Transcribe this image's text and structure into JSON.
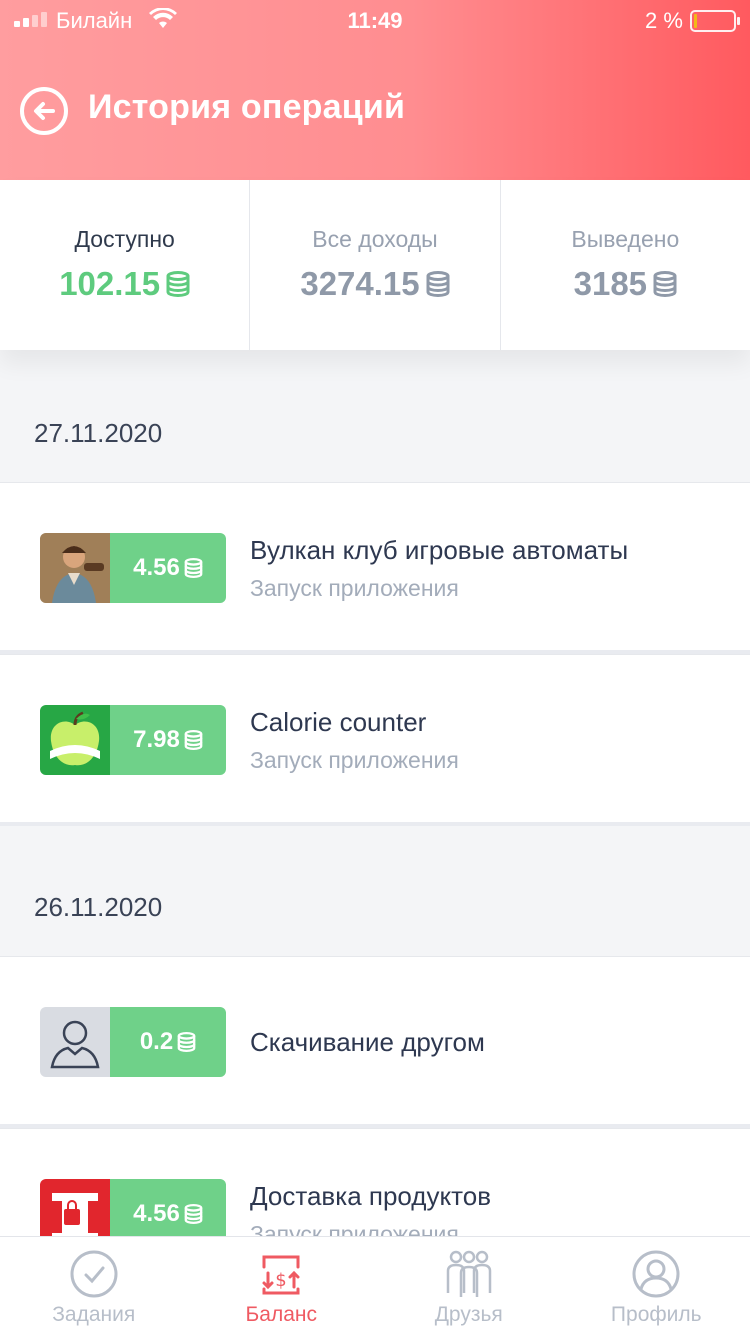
{
  "status_bar": {
    "carrier": "Билайн",
    "time": "11:49",
    "battery": "2 %"
  },
  "header": {
    "title": "История операций"
  },
  "summary": [
    {
      "label": "Доступно",
      "value": "102.15"
    },
    {
      "label": "Все доходы",
      "value": "3274.15"
    },
    {
      "label": "Выведено",
      "value": "3185"
    }
  ],
  "groups": [
    {
      "date": "27.11.2020",
      "items": [
        {
          "amount": "4.56",
          "title": "Вулкан клуб игровые автоматы",
          "subtitle": "Запуск приложения",
          "icon": "slot-app-icon"
        },
        {
          "amount": "7.98",
          "title": "Calorie counter",
          "subtitle": "Запуск приложения",
          "icon": "calorie-app-icon"
        }
      ]
    },
    {
      "date": "26.11.2020",
      "items": [
        {
          "amount": "0.2",
          "title": "Скачивание другом",
          "subtitle": "",
          "icon": "user-avatar-icon"
        },
        {
          "amount": "4.56",
          "title": "Доставка продуктов",
          "subtitle": "Запуск приложения",
          "icon": "delivery-app-icon"
        }
      ]
    }
  ],
  "tabs": [
    {
      "label": "Задания",
      "icon": "check-circle-icon"
    },
    {
      "label": "Баланс",
      "icon": "balance-icon"
    },
    {
      "label": "Друзья",
      "icon": "friends-icon"
    },
    {
      "label": "Профиль",
      "icon": "profile-icon"
    }
  ],
  "colors": {
    "accent": "#ef5a62",
    "green": "#6fd189",
    "header_start": "#ff9d9f",
    "header_end": "#ff5a5f"
  }
}
